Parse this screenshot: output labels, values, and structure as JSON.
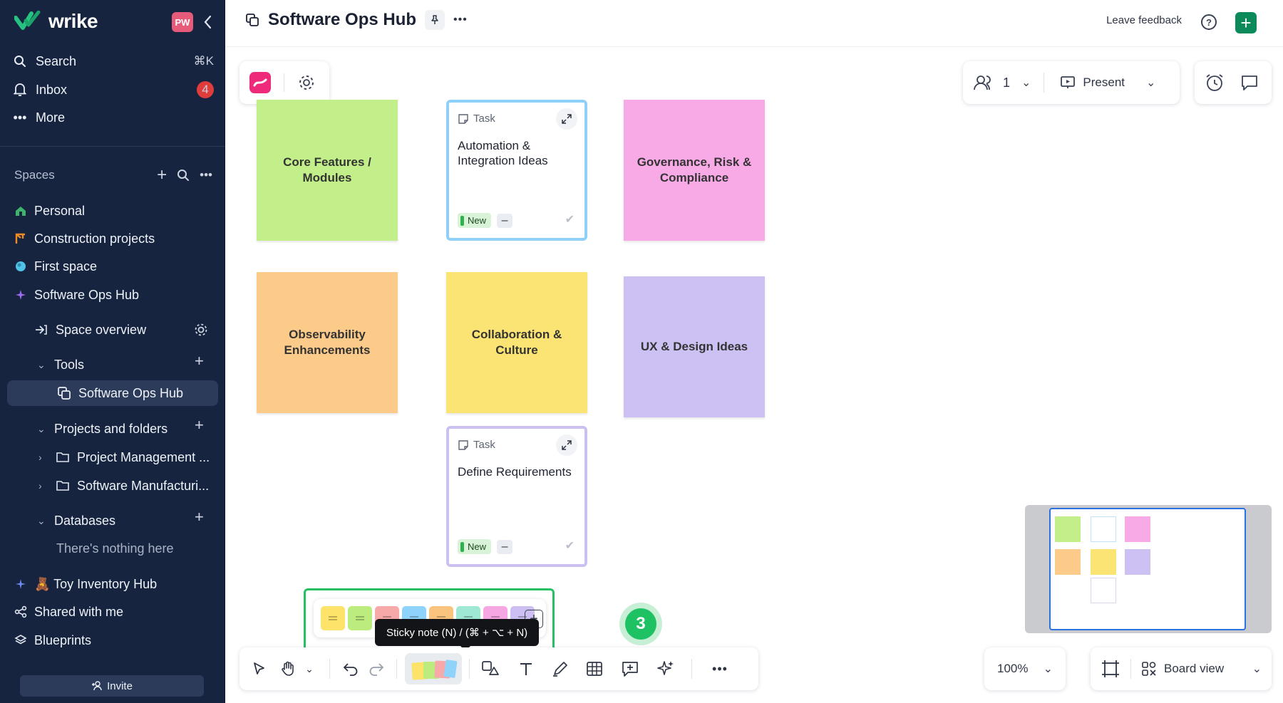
{
  "app": {
    "brand": "wrike",
    "avatar_initials": "PW"
  },
  "nav": {
    "search_label": "Search",
    "search_shortcut": "⌘K",
    "inbox_label": "Inbox",
    "inbox_count": "4",
    "more_label": "More"
  },
  "spaces": {
    "heading": "Spaces",
    "items": [
      {
        "label": "Personal",
        "color": "#3fb36b"
      },
      {
        "label": "Construction projects",
        "color": "#f08a24"
      },
      {
        "label": "First space",
        "color": "#4fc3e8"
      },
      {
        "label": "Software Ops Hub",
        "color": "#9b6cf0"
      }
    ],
    "space_overview": "Space overview",
    "tools": "Tools",
    "active_tool": "Software Ops Hub",
    "projects_and_folders": "Projects and folders",
    "folders": [
      "Project Management ...",
      "Software Manufacturi..."
    ],
    "databases": "Databases",
    "databases_empty": "There's nothing here",
    "toy_inventory": "🧸 Toy Inventory Hub",
    "shared_with_me": "Shared with me",
    "blueprints": "Blueprints"
  },
  "invite_label": "Invite",
  "header": {
    "title": "Software Ops Hub",
    "leave_feedback": "Leave feedback",
    "help": "?"
  },
  "board": {
    "participants": "1",
    "present_label": "Present",
    "stickies": [
      {
        "text": "Core Features / Modules",
        "color": "#c3ef8a"
      },
      {
        "text": "Governance, Risk & Compliance",
        "color": "#f8aae7"
      },
      {
        "text": "Observability Enhancements",
        "color": "#fccb8a"
      },
      {
        "text": "Collaboration & Culture",
        "color": "#fbe473"
      },
      {
        "text": "UX & Design Ideas",
        "color": "#cdc1f3"
      }
    ],
    "tasks": [
      {
        "label": "Task",
        "title": "Automation & Integration Ideas",
        "status": "New",
        "border": "#8fd0fa"
      },
      {
        "label": "Task",
        "title": "Define Requirements",
        "status": "New",
        "border": "#cbc0f0"
      }
    ],
    "palette_colors": [
      "#fde36a",
      "#bcec7e",
      "#f7a9a9",
      "#8fd3fb",
      "#fbc47e",
      "#9fe8d3",
      "#f7a6e4",
      "#cdbff2"
    ],
    "step_number": "3",
    "tooltip": "Sticky note (N) / (⌘ + ⌥ + N)",
    "zoom": "100%",
    "view_label": "Board view"
  }
}
